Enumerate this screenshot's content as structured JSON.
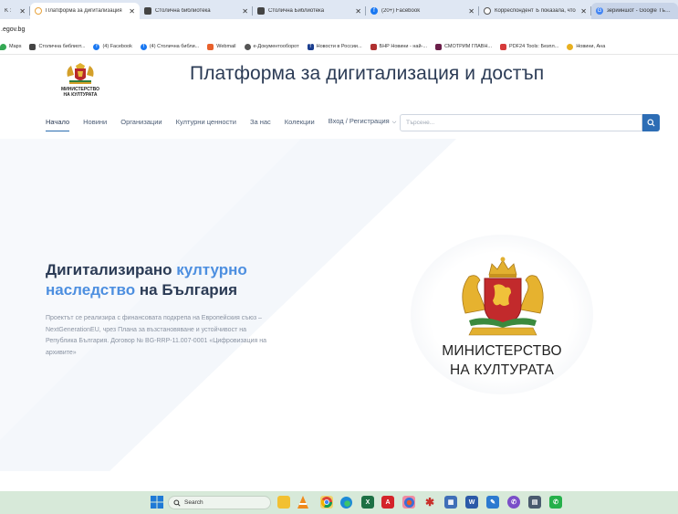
{
  "browser": {
    "tabs": [
      {
        "label": "K :",
        "icon": "partial-tab-icon",
        "color": "#666666"
      },
      {
        "label": "Платформа за дигитализация",
        "icon": "loading-icon",
        "color": "#e8a33d",
        "active": true
      },
      {
        "label": "Столична библиотека",
        "icon": "library-icon",
        "color": "#444444"
      },
      {
        "label": "Столична Библиотека",
        "icon": "library-icon",
        "color": "#444444"
      },
      {
        "label": "(20+) Facebook",
        "icon": "facebook-icon",
        "color": "#1877f2"
      },
      {
        "label": "Корреспондент Ъ показала, что",
        "icon": "globe-icon",
        "color": "#555555"
      },
      {
        "label": "зерийншот - Google Търсене",
        "icon": "google-icon",
        "color": "#4285f4"
      }
    ],
    "address": ".egov.bg",
    "bookmarks": [
      {
        "label": "Maps",
        "icon": "maps-icon",
        "color": "#34a853"
      },
      {
        "label": "Столична библиот...",
        "icon": "library-icon",
        "color": "#444444"
      },
      {
        "label": "(4) Facebook",
        "icon": "facebook-icon",
        "color": "#1877f2"
      },
      {
        "label": "(4) Столична библи...",
        "icon": "facebook-icon",
        "color": "#1877f2"
      },
      {
        "label": "Webmail",
        "icon": "webmail-icon",
        "color": "#e8612c"
      },
      {
        "label": "е-Документооборот",
        "icon": "globe-icon",
        "color": "#555555"
      },
      {
        "label": "Новости в России...",
        "icon": "news-icon",
        "color": "#1a3d8f"
      },
      {
        "label": "БНР Новини - най-...",
        "icon": "bnr-icon",
        "color": "#b03030"
      },
      {
        "label": "СМОТРИМ ГЛАВН...",
        "icon": "smotrim-icon",
        "color": "#6b1f4a"
      },
      {
        "label": "PDF24 Tools: Безпл...",
        "icon": "pdf24-icon",
        "color": "#d63a3a"
      },
      {
        "label": "Новини, Ана",
        "icon": "star-icon",
        "color": "#e8b020"
      }
    ]
  },
  "site": {
    "logo_text_line1": "МИНИСТЕРСТВО",
    "logo_text_line2": "НА КУЛТУРАТА",
    "title": "Платформа за дигитализация и достъп",
    "nav": [
      {
        "label": "Начало",
        "active": true
      },
      {
        "label": "Новини"
      },
      {
        "label": "Организации"
      },
      {
        "label": "Културни ценности"
      },
      {
        "label": "За нас"
      },
      {
        "label": "Колекции"
      },
      {
        "label": "Вход / Регистрация",
        "dropdown": true
      }
    ],
    "search_placeholder": "Търсене..."
  },
  "hero": {
    "heading_part1": "Дигитализирано ",
    "heading_part2": "културно наследство",
    "heading_part3": " на България",
    "text": "Проектът се реализира с финансовата подкрепа на Европейския съюз – NextGenerationEU, чрез Плана за възстановяване и устойчивост на Република България. Договор № BG-RRP-11.007-0001 «Цифровизация на архивите»",
    "ministry_line1": "МИНИСТЕРСТВО",
    "ministry_line2": "НА КУЛТУРАТА"
  },
  "taskbar": {
    "search_label": "Search",
    "apps": [
      "file-explorer-icon",
      "vlc-icon",
      "chrome-icon",
      "edge-icon",
      "excel-icon",
      "acrobat-icon",
      "browser-icon",
      "puzzle-icon",
      "calendar-icon",
      "word-icon",
      "paint-icon",
      "viber-icon",
      "calculator-icon",
      "whatsapp-icon"
    ]
  },
  "colors": {
    "accent": "#2d6db5",
    "heading": "#2b3b55",
    "highlight": "#4d8fe0",
    "taskbar": "#d7e9d9"
  }
}
